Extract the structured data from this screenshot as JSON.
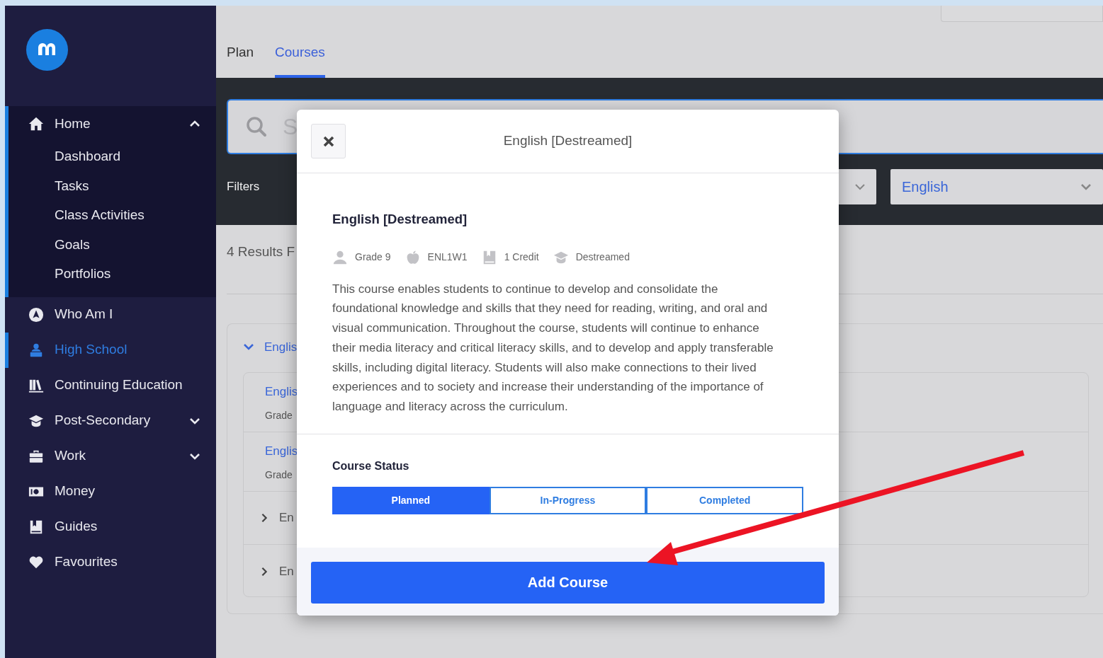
{
  "sidebar": {
    "items": [
      {
        "label": "Home",
        "kind": "group",
        "expanded": true,
        "selected": false,
        "children": [
          {
            "label": "Dashboard"
          },
          {
            "label": "Tasks"
          },
          {
            "label": "Class Activities"
          },
          {
            "label": "Goals"
          },
          {
            "label": "Portfolios"
          }
        ]
      },
      {
        "label": "Who Am I",
        "kind": "link",
        "selected": false
      },
      {
        "label": "High School",
        "kind": "link",
        "selected": true
      },
      {
        "label": "Continuing Education",
        "kind": "link",
        "selected": false
      },
      {
        "label": "Post-Secondary",
        "kind": "group",
        "expanded": false,
        "selected": false
      },
      {
        "label": "Work",
        "kind": "group",
        "expanded": false,
        "selected": false
      },
      {
        "label": "Money",
        "kind": "link",
        "selected": false
      },
      {
        "label": "Guides",
        "kind": "link",
        "selected": false
      },
      {
        "label": "Favourites",
        "kind": "link",
        "selected": false
      }
    ]
  },
  "tabs": [
    {
      "label": "Plan",
      "selected": false
    },
    {
      "label": "Courses",
      "selected": true
    }
  ],
  "search": {
    "placeholder": "S"
  },
  "filters": {
    "label": "Filters",
    "subject": "English"
  },
  "results": {
    "summary": "4 Results F",
    "group": {
      "title": "Englis",
      "expanded": true,
      "courses": [
        {
          "kind": "detail",
          "title": "Englis",
          "grade": "Grade"
        },
        {
          "kind": "detail",
          "title": "Englis",
          "grade": "Grade"
        },
        {
          "kind": "collapsed",
          "title": "En"
        },
        {
          "kind": "collapsed",
          "title": "En"
        }
      ]
    }
  },
  "modal": {
    "title": "English [Destreamed]",
    "course_name": "English [Destreamed]",
    "meta": [
      {
        "text": "Grade 9"
      },
      {
        "text": "ENL1W1"
      },
      {
        "text": "1 Credit"
      },
      {
        "text": "Destreamed"
      }
    ],
    "description": "This course enables students to continue to develop and consolidate the foundational knowledge and skills that they need for reading, writing, and oral and visual communication. Throughout the course, students will continue to enhance their media literacy and critical literacy skills, and to develop and apply transferable skills, including digital literacy. Students will also make connections to their lived experiences and to society and increase their understanding of the importance of language and literacy across the curriculum.",
    "status_label": "Course Status",
    "statuses": [
      {
        "label": "Planned",
        "selected": true
      },
      {
        "label": "In-Progress",
        "selected": false
      },
      {
        "label": "Completed",
        "selected": false
      }
    ],
    "add_button": "Add Course"
  }
}
